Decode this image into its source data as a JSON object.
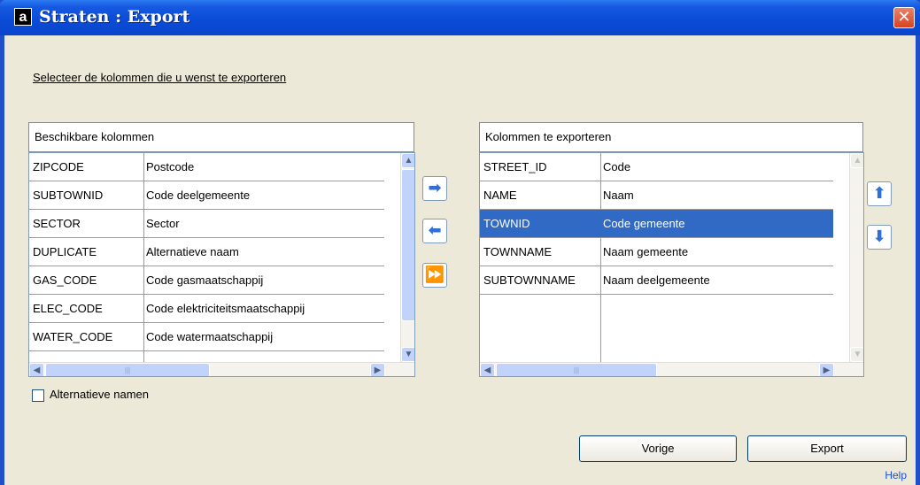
{
  "window": {
    "title": "Straten : Export",
    "close": "✕",
    "app_icon": "a"
  },
  "instruction": "Selecteer de kolommen die u wenst te exporteren",
  "available": {
    "header": "Beschikbare kolommen",
    "rows": [
      [
        "ZIPCODE",
        "Postcode"
      ],
      [
        "SUBTOWNID",
        "Code deelgemeente"
      ],
      [
        "SECTOR",
        "Sector"
      ],
      [
        "DUPLICATE",
        "Alternatieve naam"
      ],
      [
        "GAS_CODE",
        "Code gasmaatschappij"
      ],
      [
        "ELEC_CODE",
        "Code elektriciteitsmaatschappij"
      ],
      [
        "WATER_CODE",
        "Code watermaatschappij"
      ]
    ]
  },
  "export": {
    "header": "Kolommen te exporteren",
    "rows": [
      [
        "STREET_ID",
        "Code"
      ],
      [
        "NAME",
        "Naam"
      ],
      [
        "TOWNID",
        "Code gemeente"
      ],
      [
        "TOWNNAME",
        "Naam gemeente"
      ],
      [
        "SUBTOWNNAME",
        "Naam deelgemeente"
      ]
    ],
    "selected_index": 2
  },
  "move_buttons": {
    "add": "➡",
    "remove": "⬅",
    "add_all": "⏩"
  },
  "order_buttons": {
    "up": "⬆",
    "down": "⬇"
  },
  "checkbox": {
    "label": "Alternatieve namen",
    "checked": false
  },
  "buttons": {
    "previous": "Vorige",
    "export": "Export"
  },
  "help": "Help",
  "icons": {
    "scroll_up": "▲",
    "scroll_down": "▼",
    "scroll_left": "◀",
    "scroll_right": "▶",
    "grip": "|||",
    "vgrip": "≡"
  },
  "colors": {
    "titlebar": "#0a4bd6",
    "selection": "#316ac5",
    "window_bg": "#ece9d8",
    "close": "#d7421f"
  }
}
